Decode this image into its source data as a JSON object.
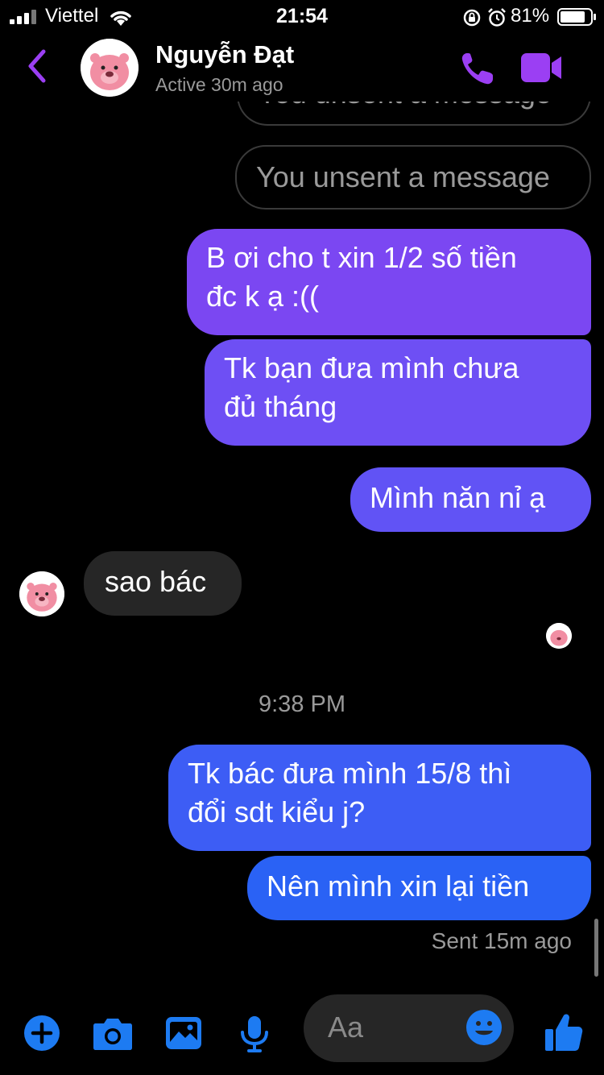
{
  "status_bar": {
    "carrier": "Viettel",
    "time": "21:54",
    "battery": "81%"
  },
  "header": {
    "name": "Nguyễn Đạt",
    "status": "Active 30m ago"
  },
  "messages": {
    "unsent_partial": "You unsent a message",
    "unsent": "You unsent a message",
    "sent1_line1": "B ơi cho t xin 1/2 số tiền",
    "sent1_line2": "đc k ạ :((",
    "sent2_line1": "Tk bạn đưa mình chưa",
    "sent2_line2": "đủ tháng",
    "sent3": "Mình năn nỉ ạ",
    "received1": "sao bác",
    "timestamp": "9:38 PM",
    "sent4_line1": "Tk bác đưa mình 15/8 thì",
    "sent4_line2": "đổi sdt kiểu j?",
    "sent5": "Nên mình xin lại tiền",
    "sent_status": "Sent 15m ago"
  },
  "composer": {
    "placeholder": "Aa"
  },
  "icons": {
    "back": "chevron-left-icon",
    "call": "phone-icon",
    "video": "video-camera-icon",
    "plus": "plus-circle-icon",
    "camera": "camera-icon",
    "gallery": "image-icon",
    "mic": "microphone-icon",
    "emoji": "smiley-icon",
    "like": "thumbs-up-icon"
  },
  "colors": {
    "accent_purple": "#9b3ff3",
    "bubble_purple": "#7b47f2",
    "bubble_blue": "#2a62f5",
    "toolbar_blue": "#1d7bf2",
    "received_bubble": "#262626"
  }
}
